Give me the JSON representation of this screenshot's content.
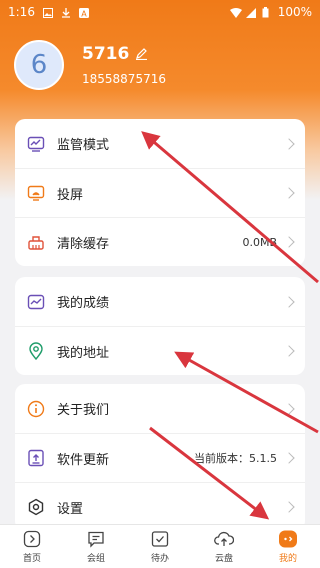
{
  "status": {
    "time": "1:16",
    "battery": "100%"
  },
  "profile": {
    "avatar_letter": "6",
    "name": "5716",
    "phone": "18558875716"
  },
  "group1": [
    {
      "label": "监管模式",
      "icon": "monitor-icon"
    },
    {
      "label": "投屏",
      "icon": "cast-icon"
    },
    {
      "label": "清除缓存",
      "icon": "broom-icon",
      "value": "0.0MB"
    }
  ],
  "group2": [
    {
      "label": "我的成绩",
      "icon": "chart-icon"
    },
    {
      "label": "我的地址",
      "icon": "location-icon"
    }
  ],
  "group3": [
    {
      "label": "关于我们",
      "icon": "info-icon"
    },
    {
      "label": "软件更新",
      "icon": "update-icon",
      "value": "当前版本：5.1.5"
    },
    {
      "label": "设置",
      "icon": "settings-icon"
    }
  ],
  "tabs": [
    {
      "label": "首页",
      "icon": "home-icon"
    },
    {
      "label": "会组",
      "icon": "chat-icon"
    },
    {
      "label": "待办",
      "icon": "todo-icon"
    },
    {
      "label": "云盘",
      "icon": "cloud-upload-icon"
    },
    {
      "label": "我的",
      "icon": "profile-icon",
      "active": true
    }
  ],
  "colors": {
    "accent": "#f07a18",
    "arrow": "#d9363e",
    "list_icon": "#6a4fb6"
  }
}
